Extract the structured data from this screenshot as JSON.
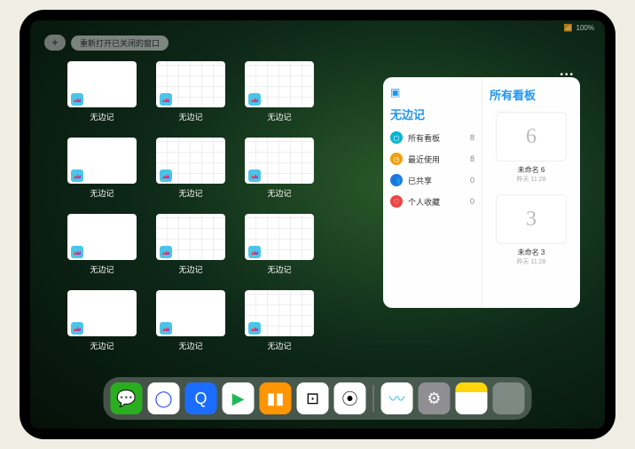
{
  "status": {
    "wifi": "📶",
    "battery": "100%"
  },
  "top": {
    "plus": "+",
    "reopen_pill": "重新打开已关闭的窗口"
  },
  "thumbs": [
    {
      "label": "无边记",
      "type": "blank"
    },
    {
      "label": "无边记",
      "type": "board"
    },
    {
      "label": "无边记",
      "type": "board"
    },
    null,
    {
      "label": "无边记",
      "type": "blank"
    },
    {
      "label": "无边记",
      "type": "board"
    },
    {
      "label": "无边记",
      "type": "board"
    },
    null,
    {
      "label": "无边记",
      "type": "blank"
    },
    {
      "label": "无边记",
      "type": "board"
    },
    {
      "label": "无边记",
      "type": "board"
    },
    null,
    {
      "label": "无边记",
      "type": "blank"
    },
    {
      "label": "无边记",
      "type": "blank"
    },
    {
      "label": "无边记",
      "type": "board"
    }
  ],
  "panel": {
    "left_title": "无边记",
    "right_title": "所有看板",
    "rows": [
      {
        "icon": "◻",
        "color": "#06b6d4",
        "label": "所有看板",
        "count": "8"
      },
      {
        "icon": "◷",
        "color": "#f59e0b",
        "label": "最近使用",
        "count": "8"
      },
      {
        "icon": "👥",
        "color": "#1e7adf",
        "label": "已共享",
        "count": "0"
      },
      {
        "icon": "♡",
        "color": "#ef4444",
        "label": "个人收藏",
        "count": "0"
      }
    ],
    "boards": [
      {
        "glyph": "6",
        "name": "未命名 6",
        "date": "昨天 11:28"
      },
      {
        "glyph": "3",
        "name": "未命名 3",
        "date": "昨天 11:28"
      }
    ]
  },
  "dock": {
    "apps": [
      {
        "name": "wechat",
        "bg": "#2aae1f",
        "glyph": "💬"
      },
      {
        "name": "browser1",
        "bg": "#ffffff",
        "glyph": "◯",
        "fg": "#2d4ef5"
      },
      {
        "name": "browser2",
        "bg": "#1a6dff",
        "glyph": "Q"
      },
      {
        "name": "play",
        "bg": "#ffffff",
        "glyph": "▶",
        "fg": "#1db954"
      },
      {
        "name": "books",
        "bg": "#ff9500",
        "glyph": "▮▮"
      },
      {
        "name": "app6",
        "bg": "#ffffff",
        "glyph": "⊡",
        "fg": "#000"
      },
      {
        "name": "app7",
        "bg": "#ffffff",
        "glyph": "⦿",
        "fg": "#000"
      }
    ],
    "recent": [
      {
        "name": "freeform",
        "bg": "#ffffff",
        "glyph": "〰",
        "fg": "#34c3eb"
      },
      {
        "name": "settings",
        "bg": "#8e8e93",
        "glyph": "⚙"
      },
      {
        "name": "notes",
        "bg": "#ffd60a",
        "glyph": ""
      },
      {
        "name": "folder",
        "bg": "",
        "glyph": ""
      }
    ]
  }
}
